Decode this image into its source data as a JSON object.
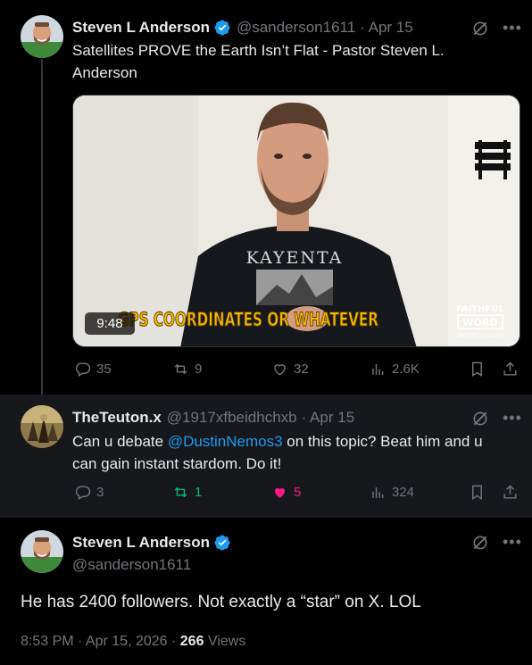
{
  "tweet1": {
    "author_name": "Steven L Anderson",
    "handle": "@sanderson1611",
    "dot_date": "· Apr 15",
    "text": "Satellites PROVE the Earth Isn’t Flat - Pastor Steven L. Anderson",
    "video": {
      "duration": "9:48",
      "caption_overlay": "GPS COORDINATES OR WHATEVER",
      "shirt_text": "KAYENTA",
      "logo_line1": "FAITHFUL",
      "logo_line2": "WORD",
      "logo_line3": "BAPTIST CHURCH"
    },
    "stats": {
      "replies": "35",
      "reposts": "9",
      "likes": "32",
      "views": "2.6K"
    }
  },
  "tweet2": {
    "author_name": "TheTeuton.x",
    "handle": "@1917xfbeidhchxb",
    "dot_date": "· Apr 15",
    "text_before": "Can u debate ",
    "mention": "@DustinNemos3",
    "text_line1_after": " on this topic? Beat him and u",
    "text_line2": "can gain instant stardom. Do it!",
    "stats": {
      "replies": "3",
      "reposts": "1",
      "likes": "5",
      "views": "324"
    }
  },
  "tweet3": {
    "author_name": "Steven L Anderson",
    "handle": "@sanderson1611",
    "text": "He has 2400 followers. Not exactly a “star” on X. LOL",
    "timestamp": "8:53 PM · Apr 15, 2026 ·",
    "views_count": "266",
    "views_label": "Views"
  },
  "colors": {
    "accent": "#1d9bf0",
    "repost_active": "#00ba7c",
    "like_active": "#f91880",
    "muted": "#71767b",
    "caption_yellow": "#f5b800"
  },
  "icons": [
    "verified-badge-icon",
    "grok-icon",
    "more-icon",
    "reply-icon",
    "repost-icon",
    "like-icon",
    "views-icon",
    "bookmark-icon",
    "share-icon"
  ]
}
